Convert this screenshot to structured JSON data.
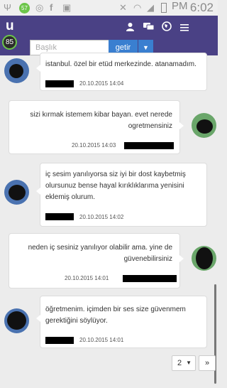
{
  "statusbar": {
    "time": "6:02",
    "pm": "PM",
    "notification_count": "57",
    "icons": [
      "usb-icon",
      "notification-badge",
      "sync-icon",
      "facebook-icon",
      "image-icon",
      "mute-icon",
      "wifi-icon",
      "signal-icon",
      "battery-icon"
    ]
  },
  "navbar": {
    "logo": "u",
    "score": "85",
    "icons": [
      "user-icon",
      "messages-icon",
      "globe-icon",
      "menu-icon"
    ]
  },
  "search": {
    "placeholder": "Başlık",
    "button_label": "getir"
  },
  "messages": [
    {
      "side": "left",
      "avatar_color": "#4a72b0",
      "text_lines": [
        "istanbul. özel bir etüd merkezinde. atanamadım."
      ],
      "time": "20.10.2015 14:04"
    },
    {
      "side": "right",
      "avatar_color": "#6aa66a",
      "text_lines": [
        "sizi kırmak istemem kibar bayan. evet nerede",
        "ogretmensiniz"
      ],
      "time": "20.10.2015 14:03"
    },
    {
      "side": "left",
      "avatar_color": "#4a72b0",
      "text_lines": [
        "iç sesim yanılıyorsa siz iyi bir dost kaybetmiş",
        "olursunuz bense hayal kırıklıklarıma yenisini",
        "eklemiş olurum."
      ],
      "time": "20.10.2015 14:02"
    },
    {
      "side": "right",
      "avatar_color": "#6aa66a",
      "text_lines": [
        "neden iç sesiniz yanılıyor olabilir ama. yine de",
        "güvenebilirsiniz"
      ],
      "time": "20.10.2015 14:01"
    },
    {
      "side": "left",
      "avatar_color": "#4a72b0",
      "text_lines": [
        "öğretmenim. içimden bir ses size güvenmem",
        "gerektiğini söylüyor."
      ],
      "time": "20.10.2015 14:01"
    }
  ],
  "pagination": {
    "current_page": "2",
    "next_label": "»"
  }
}
